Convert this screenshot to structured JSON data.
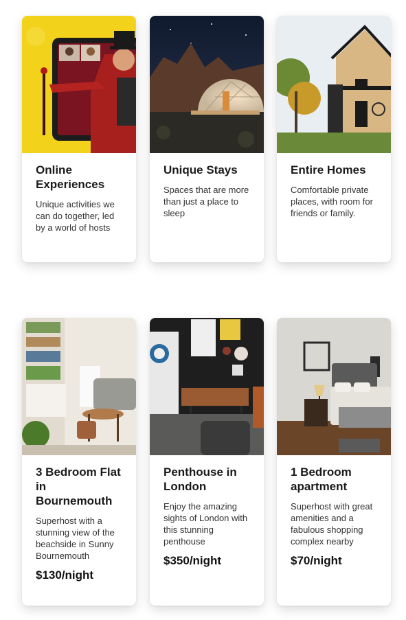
{
  "experiences": [
    {
      "title": "Online Experiences",
      "description": "Unique activities we can do together, led by a world of hosts",
      "image": "ringmaster-on-tablet-photo"
    },
    {
      "title": "Unique Stays",
      "description": "Spaces that are more than just a place to sleep",
      "image": "geodesic-dome-at-night-photo"
    },
    {
      "title": "Entire Homes",
      "description": "Comfortable private places, with room for friends or family.",
      "image": "modern-wooden-house-photo"
    }
  ],
  "listings": [
    {
      "title": "3 Bedroom Flat in Bournemouth",
      "description": "Superhost with a stunning view of the beachside in Sunny Bournemouth",
      "price": "$130/night",
      "image": "bright-living-room-photo"
    },
    {
      "title": "Penthouse in London",
      "description": "Enjoy the amazing sights of London with this stunning penthouse",
      "price": "$350/night",
      "image": "dark-penthouse-lounge-photo"
    },
    {
      "title": "1 Bedroom apartment",
      "description": "Superhost with great amenities and a fabulous shopping complex nearby",
      "price": "$70/night",
      "image": "grey-bedroom-photo"
    }
  ]
}
